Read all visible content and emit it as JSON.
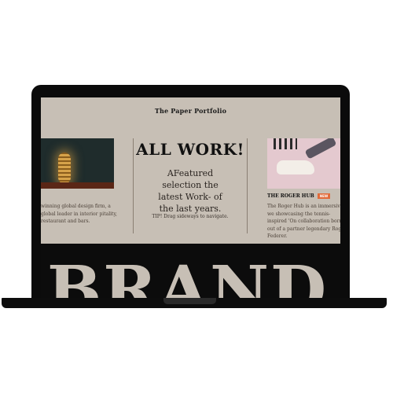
{
  "site": {
    "logo": "The Paper Portfolio"
  },
  "hero": {
    "headline": "ALL WORK!",
    "subheadline": "AFeatured selection the latest Work- of the last years.",
    "tip": "TIP! Drag sideways to navigate."
  },
  "cards": {
    "left": {
      "text": "winning global design firm, a global leader in interior pitality, restaurant and bars."
    },
    "right": {
      "title": "THE ROGER HUB",
      "badge": "NEW",
      "text": "The Roger Hub is an immersive we showcasing the tennis-inspired 'On collaboration born out of a partner legendary Roger Federer."
    }
  },
  "footer": {
    "big_word": "BRAND"
  },
  "colors": {
    "screen_bg": "#c7bfb5",
    "band_bg": "#0c0c0c",
    "badge": "#e26b3a"
  }
}
